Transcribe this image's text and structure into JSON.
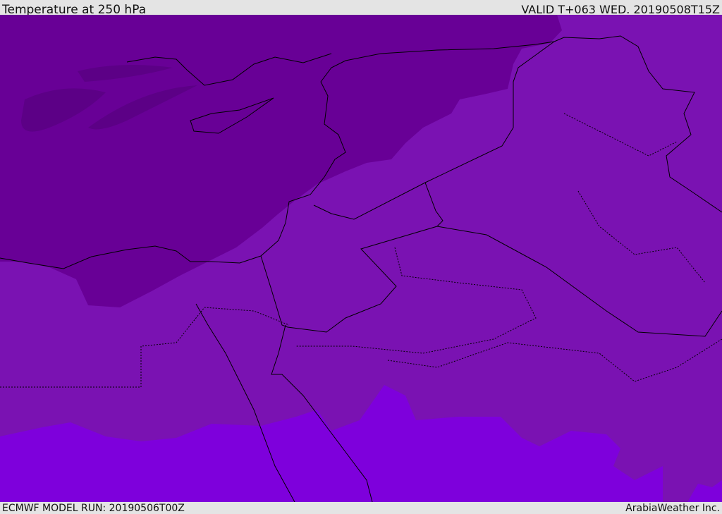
{
  "header": {
    "title": "Temperature at 250 hPa",
    "valid": "VALID T+063 WED. 20190508T15Z"
  },
  "footer": {
    "model_run": "ECMWF MODEL RUN: 20190506T00Z",
    "brand": "ArabiaWeather Inc."
  },
  "colors": {
    "base": "#7a12b2",
    "cold": "#680096",
    "colder": "#5c0086",
    "warm": "#7e00dc",
    "border": "#000000"
  }
}
